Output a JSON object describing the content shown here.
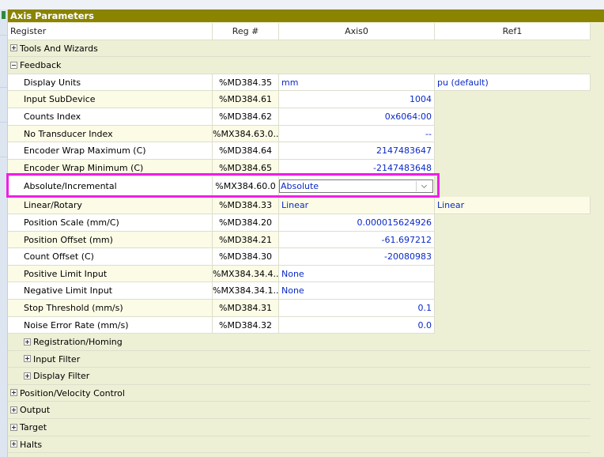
{
  "panel_title": "Axis Parameters",
  "columns": {
    "register": "Register",
    "reg_num": "Reg #",
    "axis0": "Axis0",
    "ref1": "Ref1"
  },
  "groups": {
    "tools": "Tools And Wizards",
    "feedback": "Feedback",
    "registration": "Registration/Homing",
    "input_filter": "Input Filter",
    "display_filter": "Display Filter",
    "pos_vel": "Position/Velocity Control",
    "output": "Output",
    "target": "Target",
    "halts": "Halts"
  },
  "rows": [
    {
      "name": "Display Units",
      "reg": "%MD384.35",
      "axis0": "mm",
      "ref1": "pu (default)"
    },
    {
      "name": "Input SubDevice",
      "reg": "%MD384.61",
      "axis0": "1004",
      "ref1": ""
    },
    {
      "name": "Counts Index",
      "reg": "%MD384.62",
      "axis0": "0x6064:00",
      "ref1": ""
    },
    {
      "name": "No Transducer Index",
      "reg": "%MX384.63.0...",
      "axis0": "--",
      "ref1": ""
    },
    {
      "name": "Encoder Wrap Maximum (C)",
      "reg": "%MD384.64",
      "axis0": "2147483647",
      "ref1": ""
    },
    {
      "name": "Encoder Wrap Minimum (C)",
      "reg": "%MD384.65",
      "axis0": "-2147483648",
      "ref1": ""
    },
    {
      "name": "Absolute/Incremental",
      "reg": "%MX384.60.0",
      "axis0": "Absolute",
      "ref1": ""
    },
    {
      "name": "Linear/Rotary",
      "reg": "%MD384.33",
      "axis0": "Linear",
      "ref1": "Linear"
    },
    {
      "name": "Position Scale (mm/C)",
      "reg": "%MD384.20",
      "axis0": "0.000015624926",
      "ref1": ""
    },
    {
      "name": "Position Offset (mm)",
      "reg": "%MD384.21",
      "axis0": "-61.697212",
      "ref1": ""
    },
    {
      "name": "Count Offset (C)",
      "reg": "%MD384.30",
      "axis0": "-20080983",
      "ref1": ""
    },
    {
      "name": "Positive Limit Input",
      "reg": "%MX384.34.4...",
      "axis0": "None",
      "ref1": ""
    },
    {
      "name": "Negative Limit Input",
      "reg": "%MX384.34.1...",
      "axis0": "None",
      "ref1": ""
    },
    {
      "name": "Stop Threshold (mm/s)",
      "reg": "%MD384.31",
      "axis0": "0.1",
      "ref1": ""
    },
    {
      "name": "Noise Error Rate (mm/s)",
      "reg": "%MD384.32",
      "axis0": "0.0",
      "ref1": ""
    }
  ]
}
